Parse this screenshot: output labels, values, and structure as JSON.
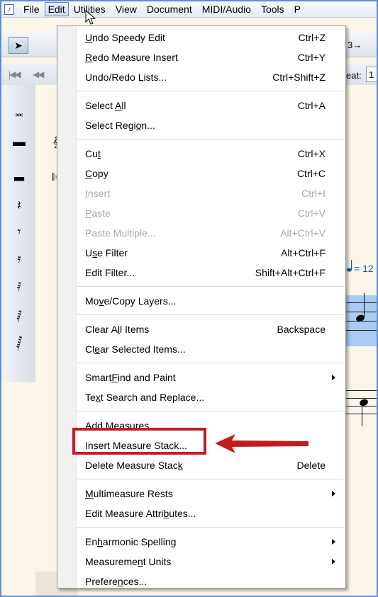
{
  "menubar": {
    "items": [
      "File",
      "Edit",
      "Utilities",
      "View",
      "Document",
      "MIDI/Audio",
      "Tools",
      "P"
    ]
  },
  "toolbar": {
    "beat_label": "eat:",
    "beat_value": "1",
    "tuplet_label": "3→"
  },
  "score": {
    "tempo": "= 12"
  },
  "edit_menu": {
    "items": [
      {
        "pre": "",
        "u": "U",
        "post": "ndo Speedy Edit",
        "shortcut": "Ctrl+Z",
        "disabled": false
      },
      {
        "pre": "",
        "u": "R",
        "post": "edo Measure Insert",
        "shortcut": "Ctrl+Y",
        "disabled": false
      },
      {
        "pre": "Undo/Redo Lists...",
        "u": "",
        "post": "",
        "shortcut": "Ctrl+Shift+Z",
        "disabled": false
      },
      {
        "pre": "Select ",
        "u": "A",
        "post": "ll",
        "shortcut": "Ctrl+A",
        "disabled": false
      },
      {
        "pre": "Select Regi",
        "u": "o",
        "post": "n...",
        "shortcut": "",
        "disabled": false
      },
      {
        "pre": "Cu",
        "u": "t",
        "post": "",
        "shortcut": "Ctrl+X",
        "disabled": false
      },
      {
        "pre": "",
        "u": "C",
        "post": "opy",
        "shortcut": "Ctrl+C",
        "disabled": false
      },
      {
        "pre": "",
        "u": "I",
        "post": "nsert",
        "shortcut": "Ctrl+I",
        "disabled": true
      },
      {
        "pre": "",
        "u": "P",
        "post": "aste",
        "shortcut": "Ctrl+V",
        "disabled": true
      },
      {
        "pre": "Paste Multiple...",
        "u": "",
        "post": "",
        "shortcut": "Alt+Ctrl+V",
        "disabled": true
      },
      {
        "pre": "U",
        "u": "s",
        "post": "e Filter",
        "shortcut": "Alt+Ctrl+F",
        "disabled": false
      },
      {
        "pre": "Edit Filter...",
        "u": "",
        "post": "",
        "shortcut": "Shift+Alt+Ctrl+F",
        "disabled": false
      },
      {
        "pre": "Mo",
        "u": "v",
        "post": "e/Copy Layers...",
        "shortcut": "",
        "disabled": false
      },
      {
        "pre": "Clear A",
        "u": "l",
        "post": "l Items",
        "shortcut": "Backspace",
        "disabled": false
      },
      {
        "pre": "Cl",
        "u": "e",
        "post": "ar Selected Items...",
        "shortcut": "",
        "disabled": false
      },
      {
        "pre": "Smart",
        "u": "F",
        "post": "ind and Paint",
        "shortcut": "",
        "disabled": false,
        "submenu": true
      },
      {
        "pre": "Te",
        "u": "x",
        "post": "t Search and Replace...",
        "shortcut": "",
        "disabled": false
      },
      {
        "pre": "Add Measures...",
        "u": "",
        "post": "",
        "shortcut": "",
        "disabled": false
      },
      {
        "pre": "Insert Measure Stack...",
        "u": "",
        "post": "",
        "shortcut": "",
        "disabled": false
      },
      {
        "pre": "Delete Measure Stac",
        "u": "k",
        "post": "",
        "shortcut": "Delete",
        "disabled": false
      },
      {
        "pre": "",
        "u": "M",
        "post": "ultimeasure Rests",
        "shortcut": "",
        "disabled": false,
        "submenu": true
      },
      {
        "pre": "Edit Measure Attri",
        "u": "b",
        "post": "utes...",
        "shortcut": "",
        "disabled": false
      },
      {
        "pre": "En",
        "u": "h",
        "post": "armonic Spelling",
        "shortcut": "",
        "disabled": false,
        "submenu": true
      },
      {
        "pre": "Measureme",
        "u": "n",
        "post": "t Units",
        "shortcut": "",
        "disabled": false,
        "submenu": true
      },
      {
        "pre": "Prefere",
        "u": "n",
        "post": "ces...",
        "shortcut": "",
        "disabled": false
      }
    ]
  },
  "colors": {
    "callout_red": "#c31b1f",
    "selection_blue": "#a9cdf2"
  }
}
